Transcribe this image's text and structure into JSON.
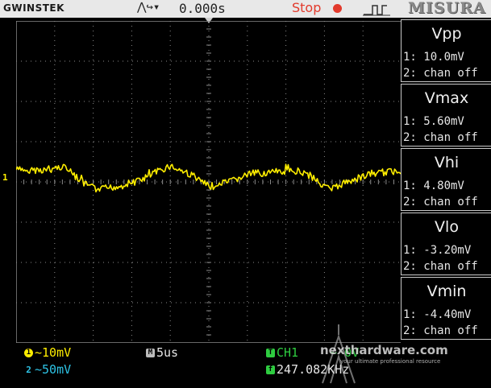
{
  "header": {
    "brand": "GWINSTEK",
    "trigger_icons": "⋀↪▾",
    "time_offset": "0.000s",
    "run_state": "Stop",
    "logo": "MISURA",
    "run_state_color": "#e23a2c"
  },
  "screen": {
    "ch1_marker": "1",
    "trace_color": "#ffee00",
    "grid_color": "#8a8a8a"
  },
  "measurements": [
    {
      "name": "Vpp",
      "ch1": "1: 10.0mV",
      "ch2": "2: chan off"
    },
    {
      "name": "Vmax",
      "ch1": "1: 5.60mV",
      "ch2": "2: chan off"
    },
    {
      "name": "Vhi",
      "ch1": "1: 4.80mV",
      "ch2": "2: chan off"
    },
    {
      "name": "Vlo",
      "ch1": "1: -3.20mV",
      "ch2": "2: chan off"
    },
    {
      "name": "Vmin",
      "ch1": "1: -4.40mV",
      "ch2": "2: chan off"
    }
  ],
  "status": {
    "ch1_badge": "1",
    "ch1_scale": "~10mV",
    "ch2_badge": "2",
    "ch2_scale": "~50mV",
    "mode_badge": "M",
    "timebase": "5us",
    "trigger_badge": "T",
    "trigger_source": "CH1",
    "trigger_level": "~ 0V",
    "freq_badge": "f",
    "frequency": "247.082KHz",
    "ch1_color": "#ffee00",
    "ch2_color": "#2ec4e6",
    "white_color": "#e6e6e6",
    "green_color": "#2ecc40"
  },
  "watermark": {
    "text": "nexthardware.com",
    "tagline": "your ultimate professional resource"
  }
}
